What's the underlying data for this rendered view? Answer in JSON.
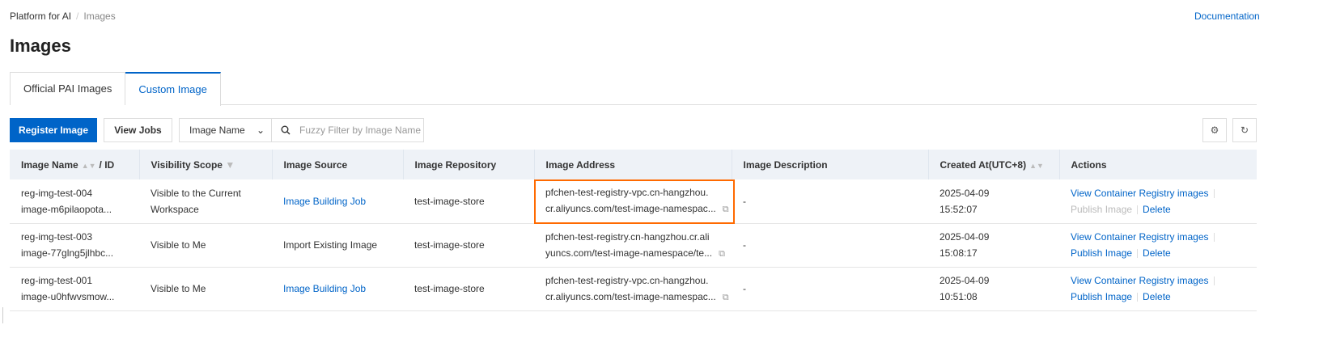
{
  "breadcrumb": {
    "root": "Platform for AI",
    "current": "Images"
  },
  "documentation": "Documentation",
  "title": "Images",
  "tabs": [
    {
      "label": "Official PAI Images"
    },
    {
      "label": "Custom Image"
    }
  ],
  "toolbar": {
    "register": "Register Image",
    "view_jobs": "View Jobs",
    "filter_field": "Image Name",
    "search_placeholder": "Fuzzy Filter by Image Name"
  },
  "columns": {
    "name": "Image Name",
    "id": "/ ID",
    "visibility": "Visibility Scope",
    "source": "Image Source",
    "repo": "Image Repository",
    "address": "Image Address",
    "description": "Image Description",
    "created": "Created At(UTC+8)",
    "actions": "Actions"
  },
  "actions": {
    "view": "View Container Registry images",
    "publish": "Publish Image",
    "delete": "Delete"
  },
  "rows": [
    {
      "name": "reg-img-test-004",
      "id": "image-m6pilaopota...",
      "visibility": "Visible to the Current Workspace",
      "source": "Image Building Job",
      "source_link": true,
      "repo": "test-image-store",
      "addr1": "pfchen-test-registry-vpc.cn-hangzhou.",
      "addr2": "cr.aliyuncs.com/test-image-namespac...",
      "description": "-",
      "date": "2025-04-09",
      "time": "15:52:07",
      "publish_disabled": true
    },
    {
      "name": "reg-img-test-003",
      "id": "image-77glng5jlhbc...",
      "visibility": "Visible to Me",
      "source": "Import Existing Image",
      "source_link": false,
      "repo": "test-image-store",
      "addr1": "pfchen-test-registry.cn-hangzhou.cr.ali",
      "addr2": "yuncs.com/test-image-namespace/te...",
      "description": "-",
      "date": "2025-04-09",
      "time": "15:08:17",
      "publish_disabled": false
    },
    {
      "name": "reg-img-test-001",
      "id": "image-u0hfwvsmow...",
      "visibility": "Visible to Me",
      "source": "Image Building Job",
      "source_link": true,
      "repo": "test-image-store",
      "addr1": "pfchen-test-registry-vpc.cn-hangzhou.",
      "addr2": "cr.aliyuncs.com/test-image-namespac...",
      "description": "-",
      "date": "2025-04-09",
      "time": "10:51:08",
      "publish_disabled": false
    }
  ]
}
